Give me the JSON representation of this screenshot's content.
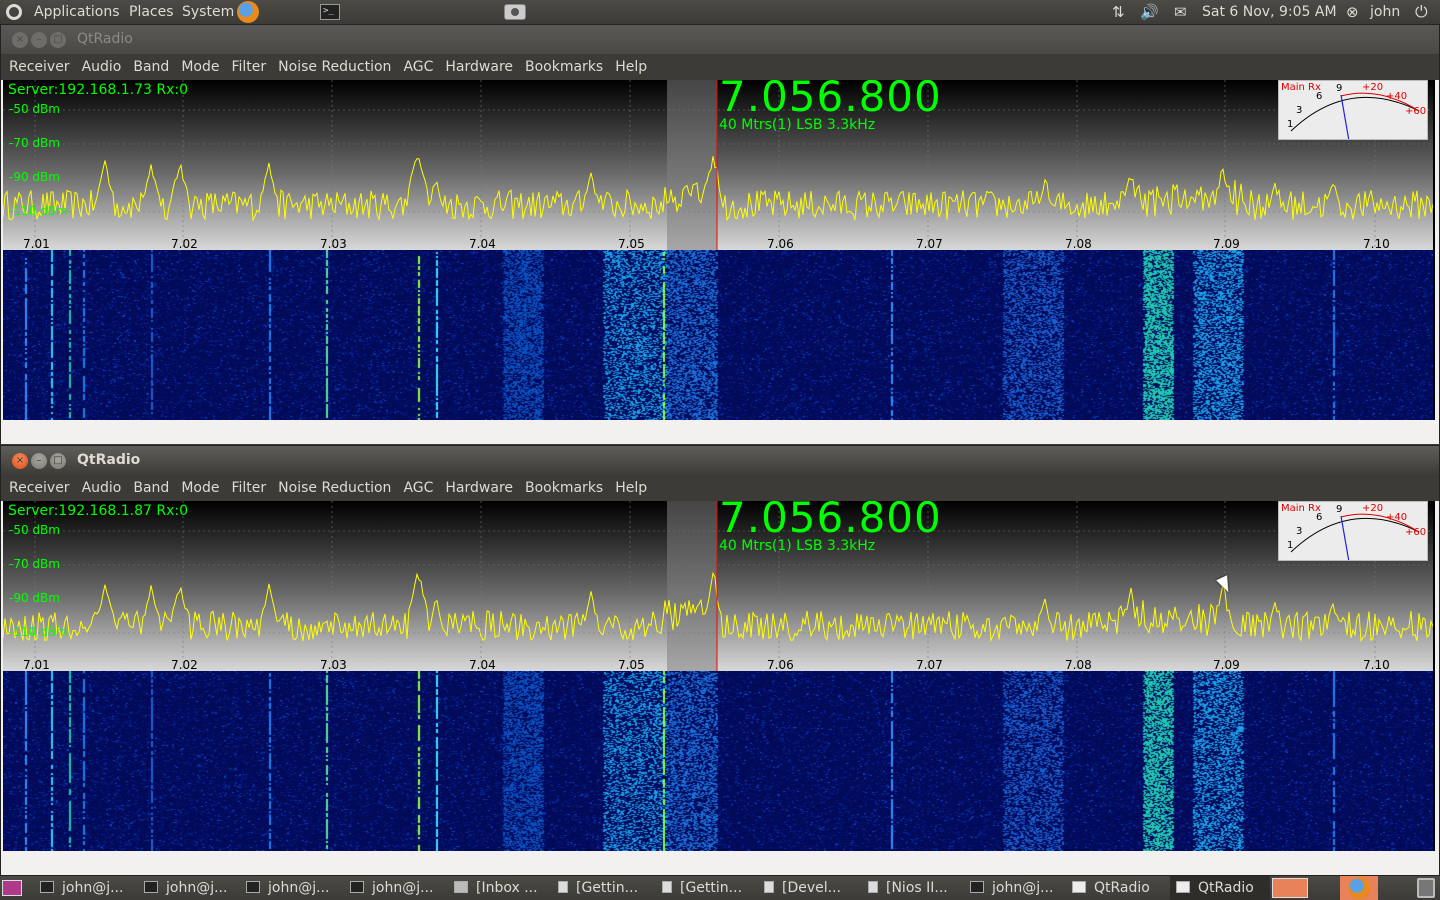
{
  "top_panel": {
    "applications": "Applications",
    "places": "Places",
    "system": "System",
    "datetime": "Sat 6 Nov, 9:05 AM",
    "user": "john",
    "icons": [
      "ubuntu-logo-icon",
      "firefox-icon",
      "terminal-icon",
      "screenshot-icon",
      "network-icon",
      "volume-icon",
      "mail-icon",
      "session-icon",
      "power-icon"
    ]
  },
  "menu": [
    "Receiver",
    "Audio",
    "Band",
    "Mode",
    "Filter",
    "Noise Reduction",
    "AGC",
    "Hardware",
    "Bookmarks",
    "Help"
  ],
  "windows": [
    {
      "title": "QtRadio",
      "active": false,
      "server": "Server:192.168.1.73 Rx:0",
      "frequency": "7.056.800",
      "mode_line": "40 Mtrs(1) LSB 3.3kHz"
    },
    {
      "title": "QtRadio",
      "active": true,
      "server": "Server:192.168.1.87 Rx:0",
      "frequency": "7.056.800",
      "mode_line": "40 Mtrs(1) LSB 3.3kHz"
    }
  ],
  "dbm_labels": [
    "-50 dBm",
    "-70 dBm",
    "-90 dBm",
    "-110 dBm"
  ],
  "freq_ticks": [
    "7.01",
    "7.02",
    "7.03",
    "7.04",
    "7.05",
    "7.06",
    "7.07",
    "7.08",
    "7.09",
    "7.10"
  ],
  "meter": {
    "label": "Main Rx",
    "scale": [
      "1",
      "3",
      "6",
      "9",
      "+20",
      "+40",
      "+60"
    ]
  },
  "taskbar": [
    {
      "label": "john@j...",
      "icon": "terminal-icon"
    },
    {
      "label": "john@j...",
      "icon": "terminal-icon"
    },
    {
      "label": "john@j...",
      "icon": "terminal-icon"
    },
    {
      "label": "john@j...",
      "icon": "terminal-icon"
    },
    {
      "label": "[Inbox ...",
      "icon": "mail-icon"
    },
    {
      "label": "[Gettin...",
      "icon": "document-icon"
    },
    {
      "label": "[Gettin...",
      "icon": "document-icon"
    },
    {
      "label": "[Devel...",
      "icon": "document-icon"
    },
    {
      "label": "[Nios II...",
      "icon": "document-icon"
    },
    {
      "label": "john@j...",
      "icon": "terminal-icon"
    },
    {
      "label": "QtRadio",
      "icon": "window-icon"
    },
    {
      "label": "QtRadio",
      "icon": "window-icon"
    }
  ],
  "colors": {
    "spectrum": "#ffff00",
    "text_green": "#00ff00",
    "filter_band": "#808080",
    "cursor_line": "#ff0000"
  }
}
